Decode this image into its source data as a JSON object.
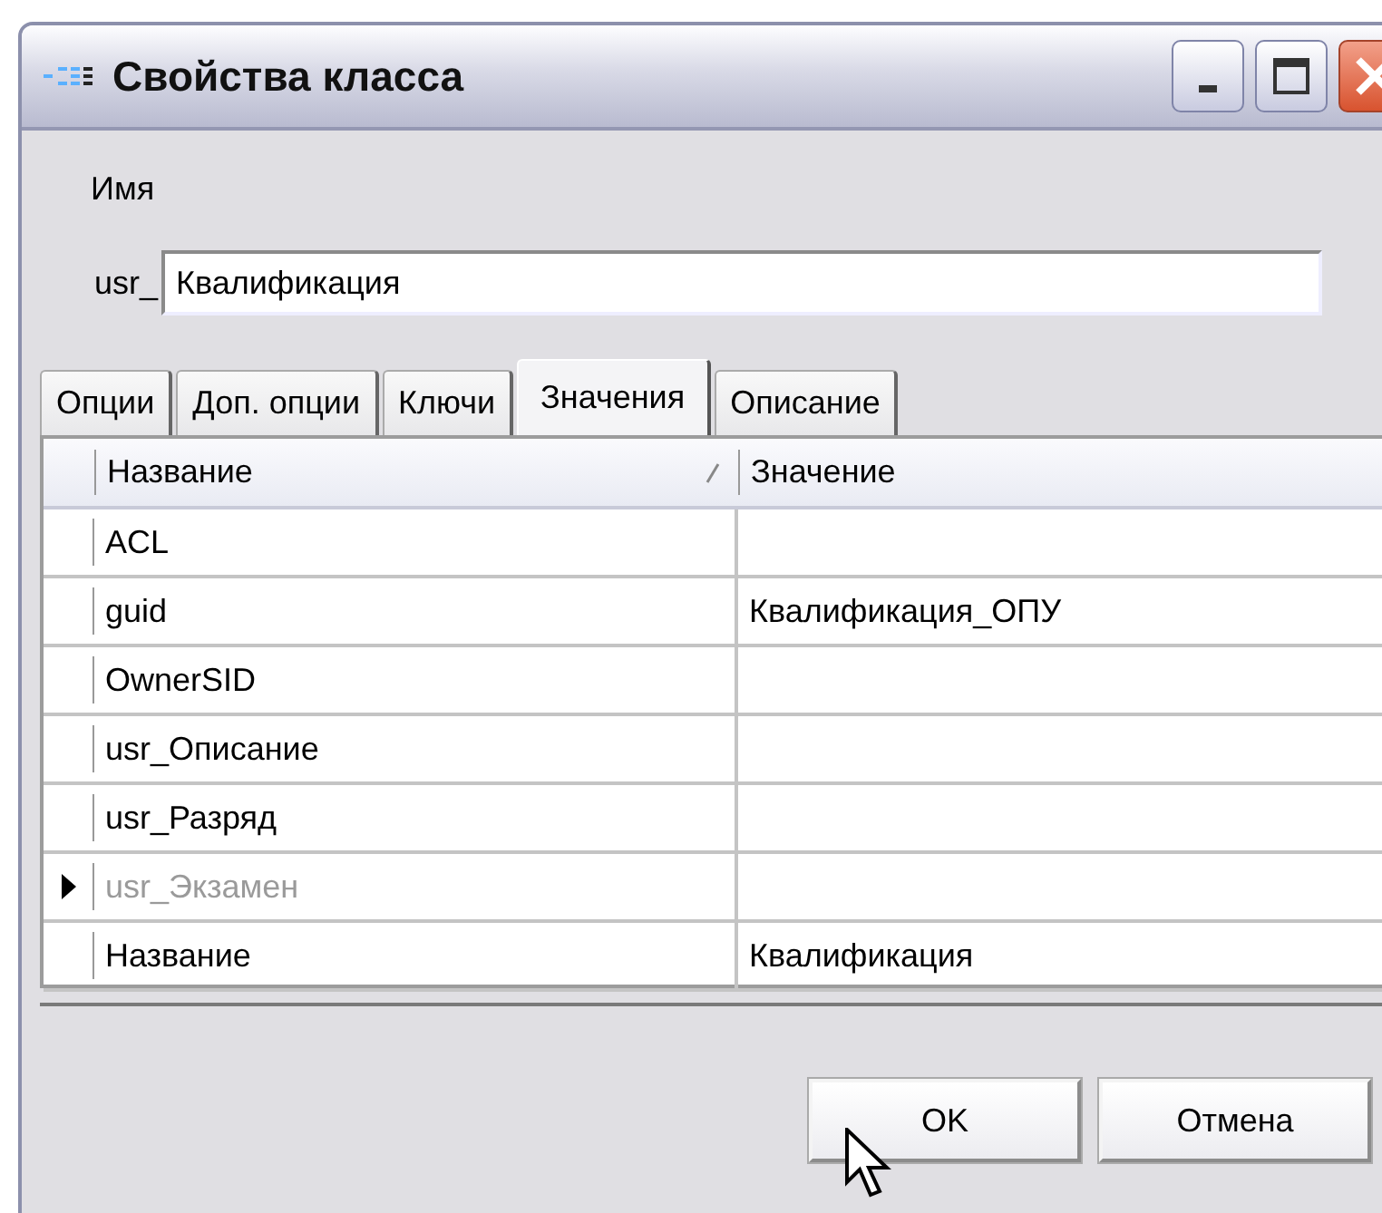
{
  "window": {
    "title": "Свойства класса"
  },
  "name_label": "Имя",
  "name_prefix": "usr_",
  "name_field": {
    "value": "Квалификация"
  },
  "tabs": [
    {
      "label": "Опции",
      "selected": false
    },
    {
      "label": "Доп. опции",
      "selected": false
    },
    {
      "label": "Ключи",
      "selected": false
    },
    {
      "label": "Значения",
      "selected": true
    },
    {
      "label": "Описание",
      "selected": false
    }
  ],
  "table": {
    "columns": [
      {
        "label": "Название",
        "sorted": true
      },
      {
        "label": "Значение",
        "sorted": false
      }
    ],
    "rows": [
      {
        "name": "ACL",
        "selected": false,
        "disabled": false
      },
      {
        "name": "guid",
        "value": "Квалификация_ОПУ",
        "selected": false,
        "disabled": false
      },
      {
        "name": "OwnerSID",
        "selected": false,
        "disabled": false
      },
      {
        "name": "usr_Описание",
        "selected": false,
        "disabled": false
      },
      {
        "name": "usr_Разряд",
        "selected": false,
        "disabled": false
      },
      {
        "name": "usr_Экзамен",
        "selected": true,
        "disabled": true
      },
      {
        "name": "Название",
        "value": "Квалификация",
        "selected": false,
        "disabled": false
      }
    ]
  },
  "buttons": [
    "OK",
    "Отмена"
  ]
}
